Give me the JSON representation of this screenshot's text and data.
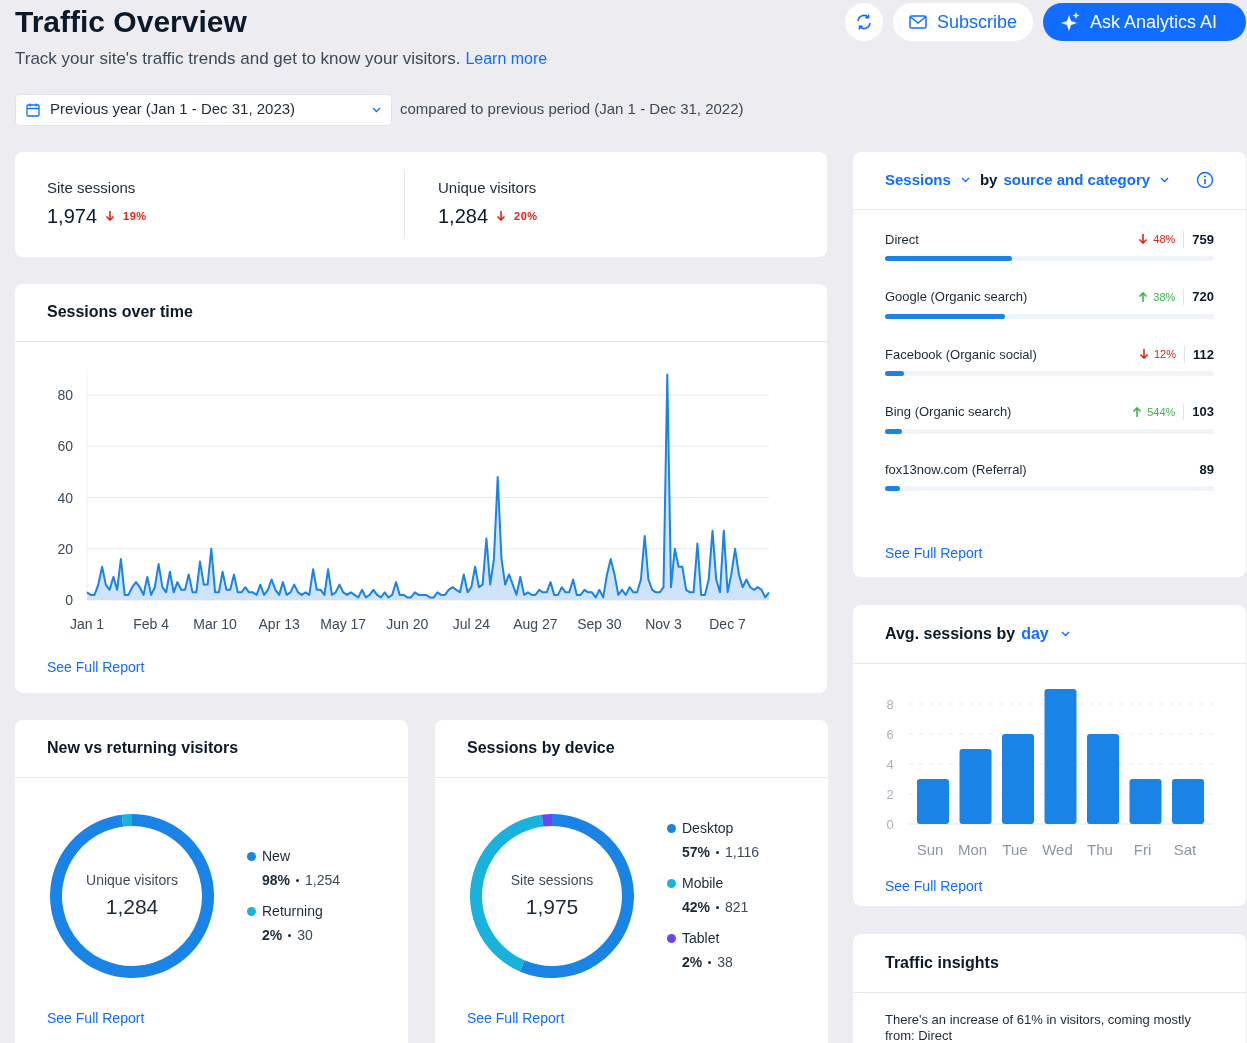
{
  "header": {
    "title": "Traffic Overview",
    "subtitle": "Track your site's traffic trends and get to know your visitors.",
    "learn_more": "Learn more",
    "buttons": [
      {
        "kind": "refresh"
      },
      {
        "kind": "subscribe",
        "label": "Subscribe"
      },
      {
        "kind": "ai",
        "label": "Ask Analytics AI"
      }
    ]
  },
  "date_filter": {
    "value": "Previous year (Jan 1 - Dec 31, 2023)",
    "comparison": "compared to previous period (Jan 1 - Dec 31, 2022)"
  },
  "stats": [
    {
      "label": "Site sessions",
      "value": "1,974",
      "change": "19%",
      "increase": false
    },
    {
      "label": "Unique visitors",
      "value": "1,284",
      "change": "20%",
      "increase": false
    }
  ],
  "sessions_over_time": {
    "title": "Sessions over time",
    "link": "See Full Report",
    "chart_data": {
      "type": "area",
      "categories": [
        "Jan 1",
        null,
        null,
        null,
        null,
        null,
        null,
        null,
        null,
        null,
        null,
        null,
        null,
        null,
        null,
        null,
        null,
        "Feb 4",
        null,
        null,
        null,
        null,
        null,
        null,
        null,
        null,
        null,
        null,
        null,
        null,
        null,
        null,
        null,
        null,
        "Mar 10",
        null,
        null,
        null,
        null,
        null,
        null,
        null,
        null,
        null,
        null,
        null,
        null,
        null,
        null,
        null,
        null,
        "Apr 13",
        null,
        null,
        null,
        null,
        null,
        null,
        null,
        null,
        null,
        null,
        null,
        null,
        null,
        null,
        null,
        null,
        "May 17",
        null,
        null,
        null,
        null,
        null,
        null,
        null,
        null,
        null,
        null,
        null,
        null,
        null,
        null,
        null,
        null,
        "Jun 20",
        null,
        null,
        null,
        null,
        null,
        null,
        null,
        null,
        null,
        null,
        null,
        null,
        null,
        null,
        null,
        null,
        "Jul 24",
        null,
        null,
        null,
        null,
        null,
        null,
        null,
        null,
        null,
        null,
        null,
        null,
        null,
        null,
        null,
        null,
        "Aug 27",
        null,
        null,
        null,
        null,
        null,
        null,
        null,
        null,
        null,
        null,
        null,
        null,
        null,
        null,
        null,
        null,
        "Sep 30",
        null,
        null,
        null,
        null,
        null,
        null,
        null,
        null,
        null,
        null,
        null,
        null,
        null,
        null,
        null,
        null,
        "Nov 3",
        null,
        null,
        null,
        null,
        null,
        null,
        null,
        null,
        null,
        null,
        null,
        null,
        null,
        null,
        null,
        null,
        "Dec 7",
        null,
        null,
        null,
        null,
        null,
        null,
        null,
        null,
        null,
        null,
        null
      ],
      "values": [
        3,
        2,
        2,
        6,
        13,
        6,
        4,
        9,
        4,
        16,
        2,
        2,
        5,
        7,
        5,
        2,
        9,
        2,
        5,
        14,
        5,
        3,
        11,
        3,
        7,
        4,
        4,
        10,
        3,
        3,
        15,
        6,
        6,
        20,
        3,
        3,
        11,
        4,
        4,
        10,
        3,
        3,
        5,
        3,
        3,
        2,
        6,
        2,
        4,
        8,
        4,
        2,
        7,
        2,
        3,
        6,
        3,
        2,
        3,
        2,
        12,
        4,
        4,
        2,
        12,
        2,
        3,
        6,
        3,
        2,
        3,
        2,
        1,
        4,
        1,
        2,
        4,
        2,
        1,
        3,
        1,
        2,
        7,
        2,
        2,
        1,
        1,
        3,
        2,
        2,
        2,
        1,
        1,
        3,
        2,
        2,
        4,
        5,
        4,
        3,
        10,
        3,
        5,
        13,
        5,
        6,
        24,
        6,
        16,
        48,
        16,
        6,
        10,
        6,
        2,
        9,
        2,
        3,
        2,
        2,
        4,
        3,
        3,
        7,
        2,
        2,
        5,
        3,
        3,
        8,
        2,
        2,
        4,
        3,
        3,
        1,
        4,
        1,
        10,
        16,
        10,
        2,
        4,
        2,
        5,
        3,
        3,
        8,
        25,
        8,
        4,
        3,
        3,
        5,
        88,
        5,
        20,
        13,
        13,
        4,
        3,
        3,
        22,
        2,
        2,
        8,
        27,
        8,
        3,
        27,
        3,
        10,
        20,
        10,
        5,
        8,
        5,
        4,
        5,
        4,
        1,
        3
      ],
      "ylim": [
        0,
        90
      ],
      "yticks": [
        0,
        20,
        40,
        60,
        80
      ],
      "grid": true
    }
  },
  "donuts": [
    {
      "title": "New vs returning visitors",
      "center_label": "Unique visitors",
      "center_value": "1,284",
      "link": "See Full Report",
      "legend": [
        {
          "label": "New",
          "percent": "98%",
          "count": "1,254",
          "color": "#1a83e6"
        },
        {
          "label": "Returning",
          "percent": "2%",
          "count": "30",
          "color": "#19b2dd"
        }
      ],
      "chart_data": {
        "type": "donut",
        "values": [
          98,
          2
        ]
      }
    },
    {
      "title": "Sessions by device",
      "center_label": "Site sessions",
      "center_value": "1,975",
      "link": "See Full Report",
      "legend": [
        {
          "label": "Desktop",
          "percent": "57%",
          "count": "1,116",
          "color": "#1a83e6"
        },
        {
          "label": "Mobile",
          "percent": "42%",
          "count": "821",
          "color": "#19b2dd"
        },
        {
          "label": "Tablet",
          "percent": "2%",
          "count": "38",
          "color": "#6a45f5"
        }
      ],
      "chart_data": {
        "type": "donut",
        "values": [
          57,
          42,
          2
        ]
      }
    }
  ],
  "source_breakdown": {
    "metric": "Sessions",
    "by": "by",
    "dimension": "source and category",
    "link": "See Full Report",
    "rows": [
      {
        "label": "Direct",
        "change": "48%",
        "increase": false,
        "value": "759",
        "level": 0.385
      },
      {
        "label": "Google (Organic search)",
        "change": "38%",
        "increase": true,
        "value": "720",
        "level": 0.365
      },
      {
        "label": "Facebook (Organic social)",
        "change": "12%",
        "increase": false,
        "value": "112",
        "level": 0.057
      },
      {
        "label": "Bing (Organic search)",
        "change": "544%",
        "increase": true,
        "value": "103",
        "level": 0.052
      },
      {
        "label": "fox13now.com (Referral)",
        "value": "89",
        "level": 0.045
      }
    ]
  },
  "avg_by_day": {
    "title": "Avg. sessions by",
    "dimension": "day",
    "link": "See Full Report",
    "chart_data": {
      "type": "bar",
      "categories": [
        "Sun",
        "Mon",
        "Tue",
        "Wed",
        "Thu",
        "Fri",
        "Sat"
      ],
      "values": [
        3,
        5,
        6,
        9,
        6,
        3,
        3
      ],
      "ylim": [
        0,
        9
      ],
      "yticks": [
        0,
        2,
        4,
        6,
        8
      ],
      "grid": true
    }
  },
  "traffic_insights": {
    "title": "Traffic insights",
    "text": "There's an increase of 61% in visitors, coming mostly from: Direct"
  }
}
